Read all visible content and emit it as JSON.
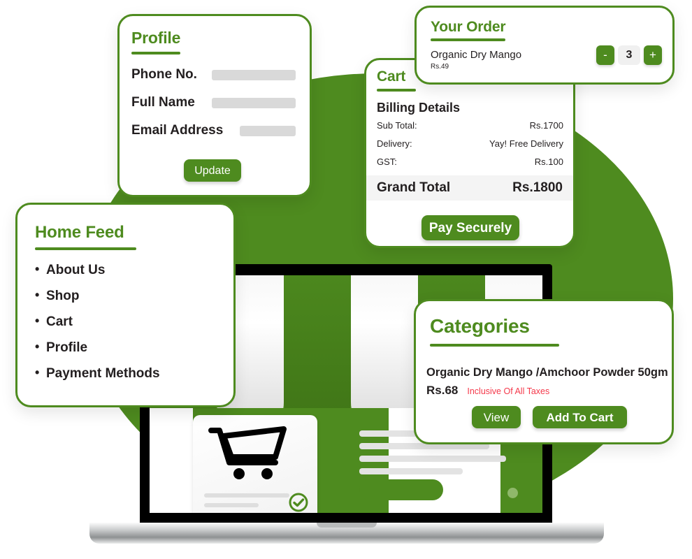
{
  "theme": {
    "brand_green": "#4e8b1f",
    "text_dark": "#231f20",
    "tax_red": "#f4394b",
    "input_gray": "#d9d9d9",
    "total_row_bg": "#f4f4f4"
  },
  "profile_card": {
    "title": "Profile",
    "fields": [
      {
        "label": "Phone No.",
        "value": "",
        "placeholder": ""
      },
      {
        "label": "Full Name",
        "value": "",
        "placeholder": ""
      },
      {
        "label": "Email Address",
        "value": "",
        "placeholder": ""
      }
    ],
    "update_button": "Update"
  },
  "order_card": {
    "title": "Your Order",
    "item_name": "Organic Dry Mango",
    "item_price": "Rs.49",
    "stepper": {
      "decrement": "-",
      "quantity": "3",
      "increment": "+"
    }
  },
  "cart_card": {
    "title": "Cart",
    "billing_heading": "Billing Details",
    "rows": [
      {
        "label": "Sub Total:",
        "value": "Rs.1700"
      },
      {
        "label": "Delivery:",
        "value": "Yay! Free Delivery"
      },
      {
        "label": "GST:",
        "value": "Rs.100"
      }
    ],
    "grand_total_label": "Grand Total",
    "grand_total_value": "Rs.1800",
    "pay_button": "Pay Securely"
  },
  "home_feed_card": {
    "title": "Home Feed",
    "items": [
      {
        "label": "About Us"
      },
      {
        "label": "Shop"
      },
      {
        "label": "Cart"
      },
      {
        "label": "Profile"
      },
      {
        "label": "Payment Methods"
      }
    ]
  },
  "categories_card": {
    "title": "Categories",
    "product_name": "Organic Dry Mango /Amchoor Powder 50gm",
    "price": "Rs.68",
    "tax_note": "Inclusive Of All Taxes",
    "view_button": "View",
    "add_to_cart_button": "Add To Cart"
  },
  "illustration": {
    "device": "laptop",
    "screen_icon": "shopping-cart-icon",
    "status_icon": "check-circle-icon"
  }
}
